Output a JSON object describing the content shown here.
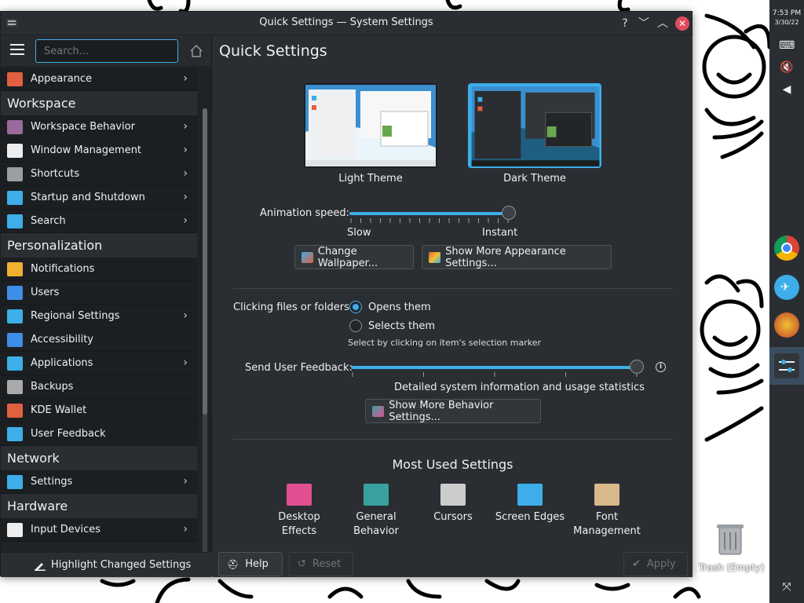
{
  "window": {
    "title": "Quick Settings — System Settings",
    "help_icon": "?",
    "min_icon": "﹀",
    "max_icon": "︿",
    "close_icon": "✕"
  },
  "sidebar": {
    "search_placeholder": "Search...",
    "sections": [
      {
        "type": "item",
        "label": "Appearance",
        "icon": "appearance-icon",
        "chevron": true,
        "color": "#e06040"
      },
      {
        "type": "header",
        "label": "Workspace"
      },
      {
        "type": "item",
        "label": "Workspace Behavior",
        "icon": "workspace-behavior-icon",
        "chevron": true,
        "color": "#9a6b9a"
      },
      {
        "type": "item",
        "label": "Window Management",
        "icon": "window-management-icon",
        "chevron": true,
        "color": "#eeeeee"
      },
      {
        "type": "item",
        "label": "Shortcuts",
        "icon": "keyboard-icon",
        "chevron": true,
        "color": "#9a9fa4"
      },
      {
        "type": "item",
        "label": "Startup and Shutdown",
        "icon": "startup-icon",
        "chevron": true,
        "color": "#3daee9"
      },
      {
        "type": "item",
        "label": "Search",
        "icon": "search-icon",
        "chevron": true,
        "color": "#3daee9"
      },
      {
        "type": "header",
        "label": "Personalization"
      },
      {
        "type": "item",
        "label": "Notifications",
        "icon": "bell-icon",
        "chevron": false,
        "color": "#f0b030"
      },
      {
        "type": "item",
        "label": "Users",
        "icon": "users-icon",
        "chevron": false,
        "color": "#3d8ee9"
      },
      {
        "type": "item",
        "label": "Regional Settings",
        "icon": "regional-icon",
        "chevron": true,
        "color": "#3daee9"
      },
      {
        "type": "item",
        "label": "Accessibility",
        "icon": "accessibility-icon",
        "chevron": false,
        "color": "#3d8ee9"
      },
      {
        "type": "item",
        "label": "Applications",
        "icon": "applications-icon",
        "chevron": true,
        "color": "#3daee9"
      },
      {
        "type": "item",
        "label": "Backups",
        "icon": "backups-icon",
        "chevron": false,
        "color": "#aaaaaa"
      },
      {
        "type": "item",
        "label": "KDE Wallet",
        "icon": "wallet-icon",
        "chevron": false,
        "color": "#e06040"
      },
      {
        "type": "item",
        "label": "User Feedback",
        "icon": "feedback-icon",
        "chevron": false,
        "color": "#3daee9"
      },
      {
        "type": "header",
        "label": "Network"
      },
      {
        "type": "item",
        "label": "Settings",
        "icon": "globe-icon",
        "chevron": true,
        "color": "#3daee9"
      },
      {
        "type": "header",
        "label": "Hardware"
      },
      {
        "type": "item",
        "label": "Input Devices",
        "icon": "input-devices-icon",
        "chevron": true,
        "color": "#eeeeee"
      }
    ],
    "highlight_label": "Highlight Changed Settings"
  },
  "main": {
    "title": "Quick Settings",
    "themes": [
      {
        "label": "Light Theme",
        "selected": false
      },
      {
        "label": "Dark Theme",
        "selected": true
      }
    ],
    "animation": {
      "label": "Animation speed:",
      "min_label": "Slow",
      "max_label": "Instant",
      "value_fraction": 1.0
    },
    "change_wallpaper": "Change Wallpaper...",
    "more_appearance": "Show More Appearance Settings...",
    "clicking": {
      "label": "Clicking files or folders:",
      "options": [
        {
          "label": "Opens them",
          "selected": true
        },
        {
          "label": "Selects them",
          "selected": false
        }
      ],
      "hint": "Select by clicking on item's selection marker"
    },
    "feedback": {
      "label": "Send User Feedback:",
      "value_fraction": 1.0,
      "description": "Detailed system information and usage statistics"
    },
    "more_behavior": "Show More Behavior Settings...",
    "most_used_title": "Most Used Settings",
    "most_used": [
      {
        "label": "Desktop\nEffects",
        "icon": "desktop-effects-icon",
        "color": "#e05090"
      },
      {
        "label": "General\nBehavior",
        "icon": "general-behavior-icon",
        "color": "#3aa0a0"
      },
      {
        "label": "Cursors",
        "icon": "cursors-icon",
        "color": "#cccccc"
      },
      {
        "label": "Screen Edges",
        "icon": "screen-edges-icon",
        "color": "#3daee9"
      },
      {
        "label": "Font\nManagement",
        "icon": "font-management-icon",
        "color": "#d9b98a"
      }
    ]
  },
  "footer": {
    "help": "Help",
    "reset": "Reset",
    "apply": "Apply"
  },
  "panel": {
    "time": "7:53 PM",
    "date": "3/30/22"
  },
  "desktop": {
    "trash_label": "Trash (Empty)"
  }
}
